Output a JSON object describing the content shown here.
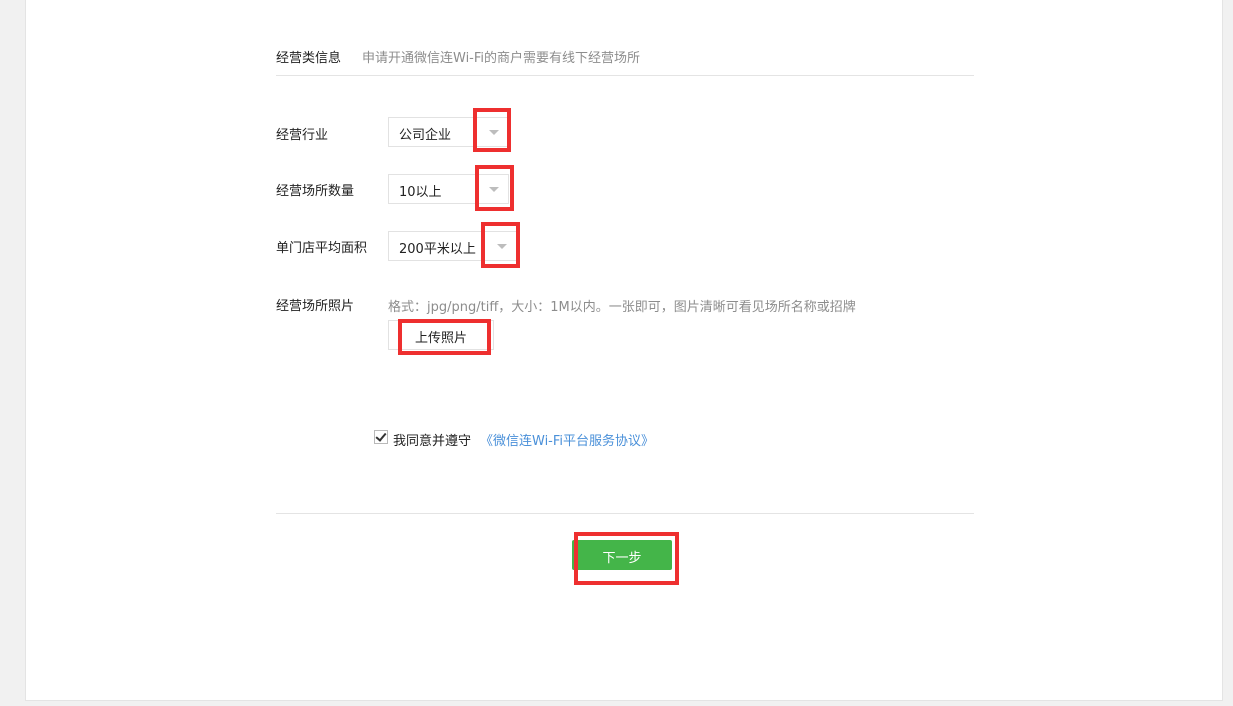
{
  "section": {
    "title": "经营类信息",
    "description": "申请开通微信连Wi-Fi的商户需要有线下经营场所"
  },
  "fields": {
    "industry": {
      "label": "经营行业",
      "value": "公司企业"
    },
    "store_count": {
      "label": "经营场所数量",
      "value": "10以上"
    },
    "avg_area": {
      "label": "单门店平均面积",
      "value": "200平米以上"
    },
    "photo": {
      "label": "经营场所照片",
      "hint": "格式：jpg/png/tiff，大小：1M以内。一张即可，图片清晰可看见场所名称或招牌",
      "button_label": "上传照片"
    }
  },
  "agreement": {
    "checked": true,
    "text": "我同意并遵守",
    "link_text": "《微信连Wi-Fi平台服务协议》"
  },
  "actions": {
    "next_label": "下一步"
  },
  "colors": {
    "primary_button": "#44b549",
    "link": "#4a90d9",
    "highlight": "#ee2f2f",
    "muted_text": "#8d8d8d"
  },
  "icons": {
    "dropdown": "chevron-down-icon",
    "checkbox": "check-icon"
  }
}
